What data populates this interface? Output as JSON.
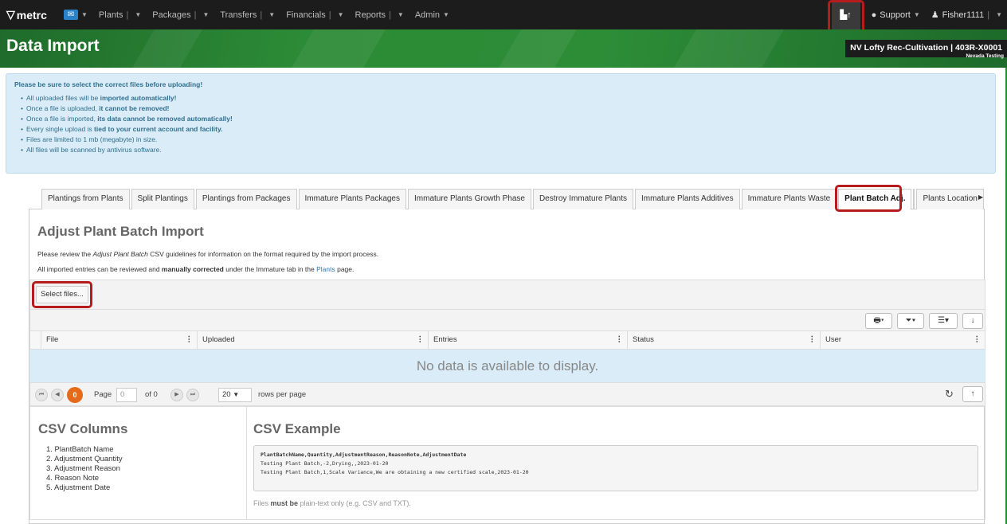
{
  "nav": {
    "brand": "metrc",
    "items": [
      "Plants",
      "Packages",
      "Transfers",
      "Financials",
      "Reports",
      "Admin"
    ],
    "support": "Support",
    "user": "Fisher1111",
    "facility": "NV Lofty Rec-Cultivation | 403R-X0001",
    "env": "Nevada Testing"
  },
  "page": {
    "title": "Data Import"
  },
  "info": {
    "head": "Please be sure to select the correct files before uploading!",
    "bullets": [
      [
        "All uploaded files will be ",
        "imported automatically!",
        ""
      ],
      [
        "Once a file is uploaded, ",
        "it cannot be removed!",
        ""
      ],
      [
        "Once a file is imported, ",
        "its data cannot be removed automatically!",
        ""
      ],
      [
        "Every single upload is ",
        "tied to your current account and facility.",
        ""
      ],
      [
        "Files are limited to 1 mb (megabyte) in size.",
        "",
        ""
      ],
      [
        "All files will be scanned by antivirus software.",
        "",
        ""
      ]
    ]
  },
  "tabs": [
    "Plantings from Plants",
    "Split Plantings",
    "Plantings from Packages",
    "Immature Plants Packages",
    "Immature Plants Growth Phase",
    "Destroy Immature Plants",
    "Immature Plants Additives",
    "Immature Plants Waste",
    "Plant Batch Adj.",
    "",
    "Plants Location"
  ],
  "section": {
    "title": "Adjust Plant Batch Import",
    "p1_pre": "Please review the ",
    "p1_em": "Adjust Plant Batch",
    "p1_post": " CSV guidelines for information on the format required by the import process.",
    "p2_pre": "All imported entries can be reviewed and ",
    "p2_bold": "manually corrected",
    "p2_mid": " under the Immature tab in the ",
    "p2_link": "Plants",
    "p2_post": " page."
  },
  "grid": {
    "select_files": "Select files...",
    "columns": [
      "File",
      "Uploaded",
      "Entries",
      "Status",
      "User"
    ],
    "empty": "No data is available to display.",
    "pager": {
      "count": "0",
      "page_label": "Page",
      "page_value": "0",
      "of": "of 0",
      "rows": "20",
      "rows_label": "rows per page"
    }
  },
  "csv": {
    "cols_title": "CSV Columns",
    "columns": [
      "1. PlantBatch Name",
      "2. Adjustment Quantity",
      "3. Adjustment Reason",
      "4. Reason Note",
      "5. Adjustment Date"
    ],
    "example_title": "CSV Example",
    "header_line": "PlantBatchName,Quantity,AdjustmentReason,ReasonNote,AdjustmentDate",
    "lines": [
      "Testing Plant Batch,-2,Drying,,2023-01-20",
      "Testing Plant Batch,1,Scale Variance,We are obtaining a new certified scale,2023-01-20"
    ],
    "note_pre": "Files ",
    "note_bold": "must be",
    "note_post": " plain-text only (e.g. CSV and TXT)."
  }
}
